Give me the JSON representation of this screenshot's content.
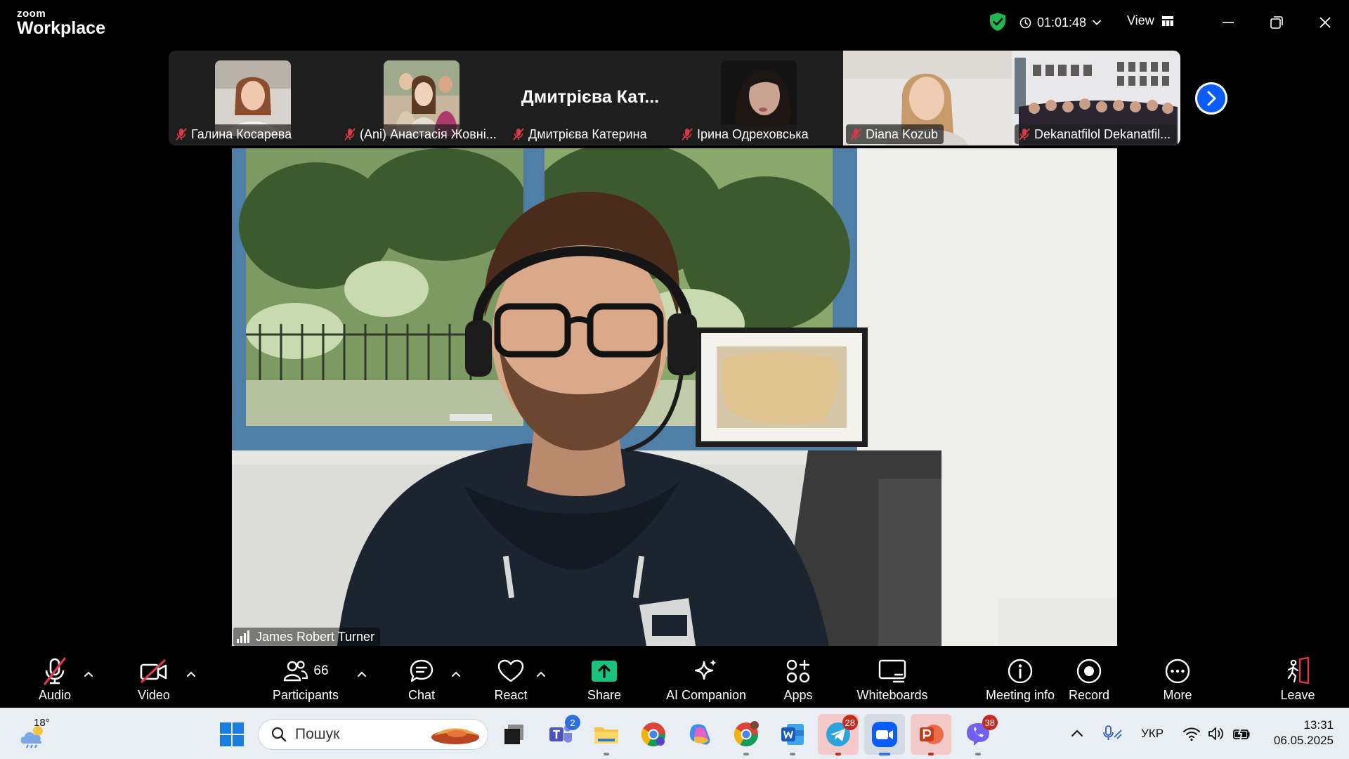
{
  "app": {
    "logo_top": "zoom",
    "logo_bottom": "Workplace"
  },
  "header": {
    "elapsed": "01:01:48",
    "view_label": "View"
  },
  "gallery": [
    {
      "name": "Галина Косарева",
      "muted": true
    },
    {
      "name": "(Ani) Анастасія Жовні...",
      "muted": true
    },
    {
      "name": "Дмитрієва Катерина",
      "display_name": "Дмитрієва Кат...",
      "muted": true
    },
    {
      "name": "Ірина Одреховська",
      "muted": true
    },
    {
      "name": "Diana Kozub",
      "muted": true
    },
    {
      "name": "Dekanatfilol Dekanatfil...",
      "muted": true
    }
  ],
  "main": {
    "speaker_name": "James Robert Turner"
  },
  "toolbar": {
    "audio": "Audio",
    "video": "Video",
    "participants": "Participants",
    "participants_count": "66",
    "chat": "Chat",
    "react": "React",
    "share": "Share",
    "ai_companion": "AI Companion",
    "apps": "Apps",
    "whiteboards": "Whiteboards",
    "meeting_info": "Meeting info",
    "record": "Record",
    "more": "More",
    "leave": "Leave"
  },
  "taskbar": {
    "weather_temp": "18°",
    "search_placeholder": "Пошук",
    "teams_badge": "2",
    "telegram_badge": "28",
    "viber_badge": "38",
    "language": "УКР",
    "time": "13:31",
    "date": "06.05.2025"
  },
  "colors": {
    "accent_blue": "#0b5cff",
    "share_green": "#19c37d",
    "mute_red": "#e0374a",
    "leave_red": "#e0374a",
    "shield_green": "#1db954"
  }
}
